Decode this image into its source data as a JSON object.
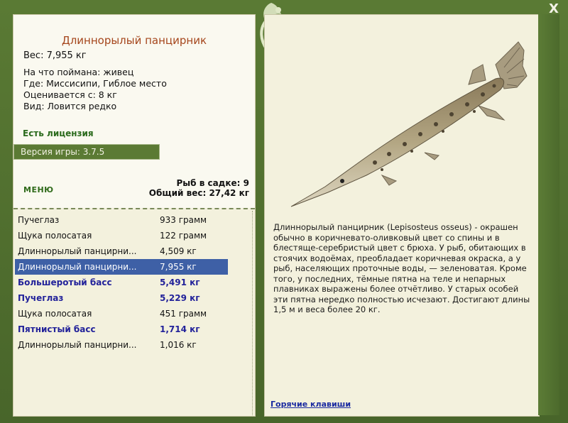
{
  "window": {
    "close_label": "X"
  },
  "fish": {
    "title": "Длиннорылый панцирник",
    "weight": "Вес: 7,955 кг",
    "bait": "На что поймана: живец",
    "place": "Где: Миссисипи, Гиблое место",
    "rated_from": "Оценивается с: 8 кг",
    "type": "Вид: Ловится редко"
  },
  "license": "Есть лицензия",
  "version": "Версия игры: 3.7.5",
  "menu_label": "МЕНЮ",
  "keepnet": {
    "count_label": "Рыб в садке: 9",
    "total_label": "Общий вес: 27,42 кг"
  },
  "catch_list": [
    {
      "name": "Пучеглаз",
      "weight": "933 грамм",
      "style": "normal"
    },
    {
      "name": "Щука полосатая",
      "weight": "122 грамм",
      "style": "normal"
    },
    {
      "name": "Длиннорылый панцирни...",
      "weight": "4,509 кг",
      "style": "normal"
    },
    {
      "name": "Длиннорылый панцирни...",
      "weight": "7,955 кг",
      "style": "selected"
    },
    {
      "name": "Большеротый басс",
      "weight": "5,491 кг",
      "style": "bold"
    },
    {
      "name": "Пучеглаз",
      "weight": "5,229 кг",
      "style": "bold"
    },
    {
      "name": "Щука полосатая",
      "weight": "451 грамм",
      "style": "normal"
    },
    {
      "name": "Пятнистый басс",
      "weight": "1,714 кг",
      "style": "bold"
    },
    {
      "name": "Длиннорылый панцирни...",
      "weight": "1,016 кг",
      "style": "normal"
    }
  ],
  "description": "Длиннорылый панцирник (Lepisosteus osseus) - окрашен обычно в коричневато-оливковый цвет со спины и в блестяще-серебристый цвет с брюха. У рыб, обитающих в стоячих водоёмах, преобладает коричневая окраска, а у рыб, населяющих проточные воды, — зеленоватая. Кроме того, у последних, тёмные пятна на теле и непарных плавниках выражены более отчётливо. У старых особей эти пятна нередко полностью исчезают. Достигают длины 1,5 м и веса более 20 кг.",
  "hotkeys_label": "Горячие клавиши",
  "colors": {
    "frame": "#4f6d2b",
    "panel": "#f3f1dd",
    "title": "#a5461c",
    "selected_row": "#3e60a6",
    "highlight_text": "#22229a"
  }
}
